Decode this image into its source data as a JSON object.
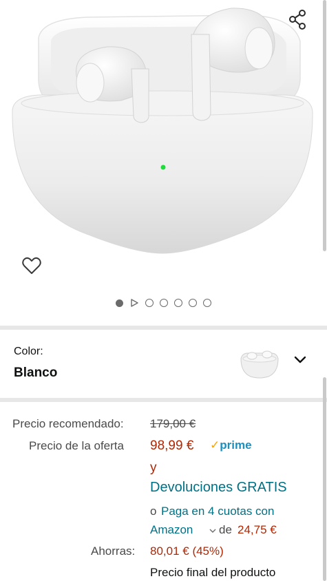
{
  "gallery": {
    "image_alt": "Auriculares inalámbricos blancos en estuche de carga",
    "indicator_count": 7,
    "active_index": 0
  },
  "icons": {
    "share": "share-icon",
    "wishlist": "heart-icon",
    "dropdown": "chevron-down-icon",
    "play": "play-icon"
  },
  "variation": {
    "label": "Color:",
    "value": "Blanco"
  },
  "pricing": {
    "list_label": "Precio recomendado:",
    "list_price": "179,00 €",
    "deal_label": "Precio de la oferta",
    "deal_price": "98,99 €",
    "prime_check": "✓",
    "prime_label": "prime",
    "and_text": "y",
    "returns_text": "Devoluciones GRATIS",
    "installments_prefix": "o",
    "installments_link_line1": "Paga en 4 cuotas con",
    "installments_link_line2": "Amazon",
    "installments_de": "de",
    "installments_amount": "24,75 €",
    "savings_label": "Ahorras:",
    "savings_value": "80,01 € (45%)",
    "final_price_text": "Precio final del producto"
  },
  "colors": {
    "price_red": "#b12704",
    "link_teal": "#007185",
    "prime_blue": "#1c8fc1",
    "divider": "#e7e7e7",
    "led_green": "#1fdc3a"
  }
}
